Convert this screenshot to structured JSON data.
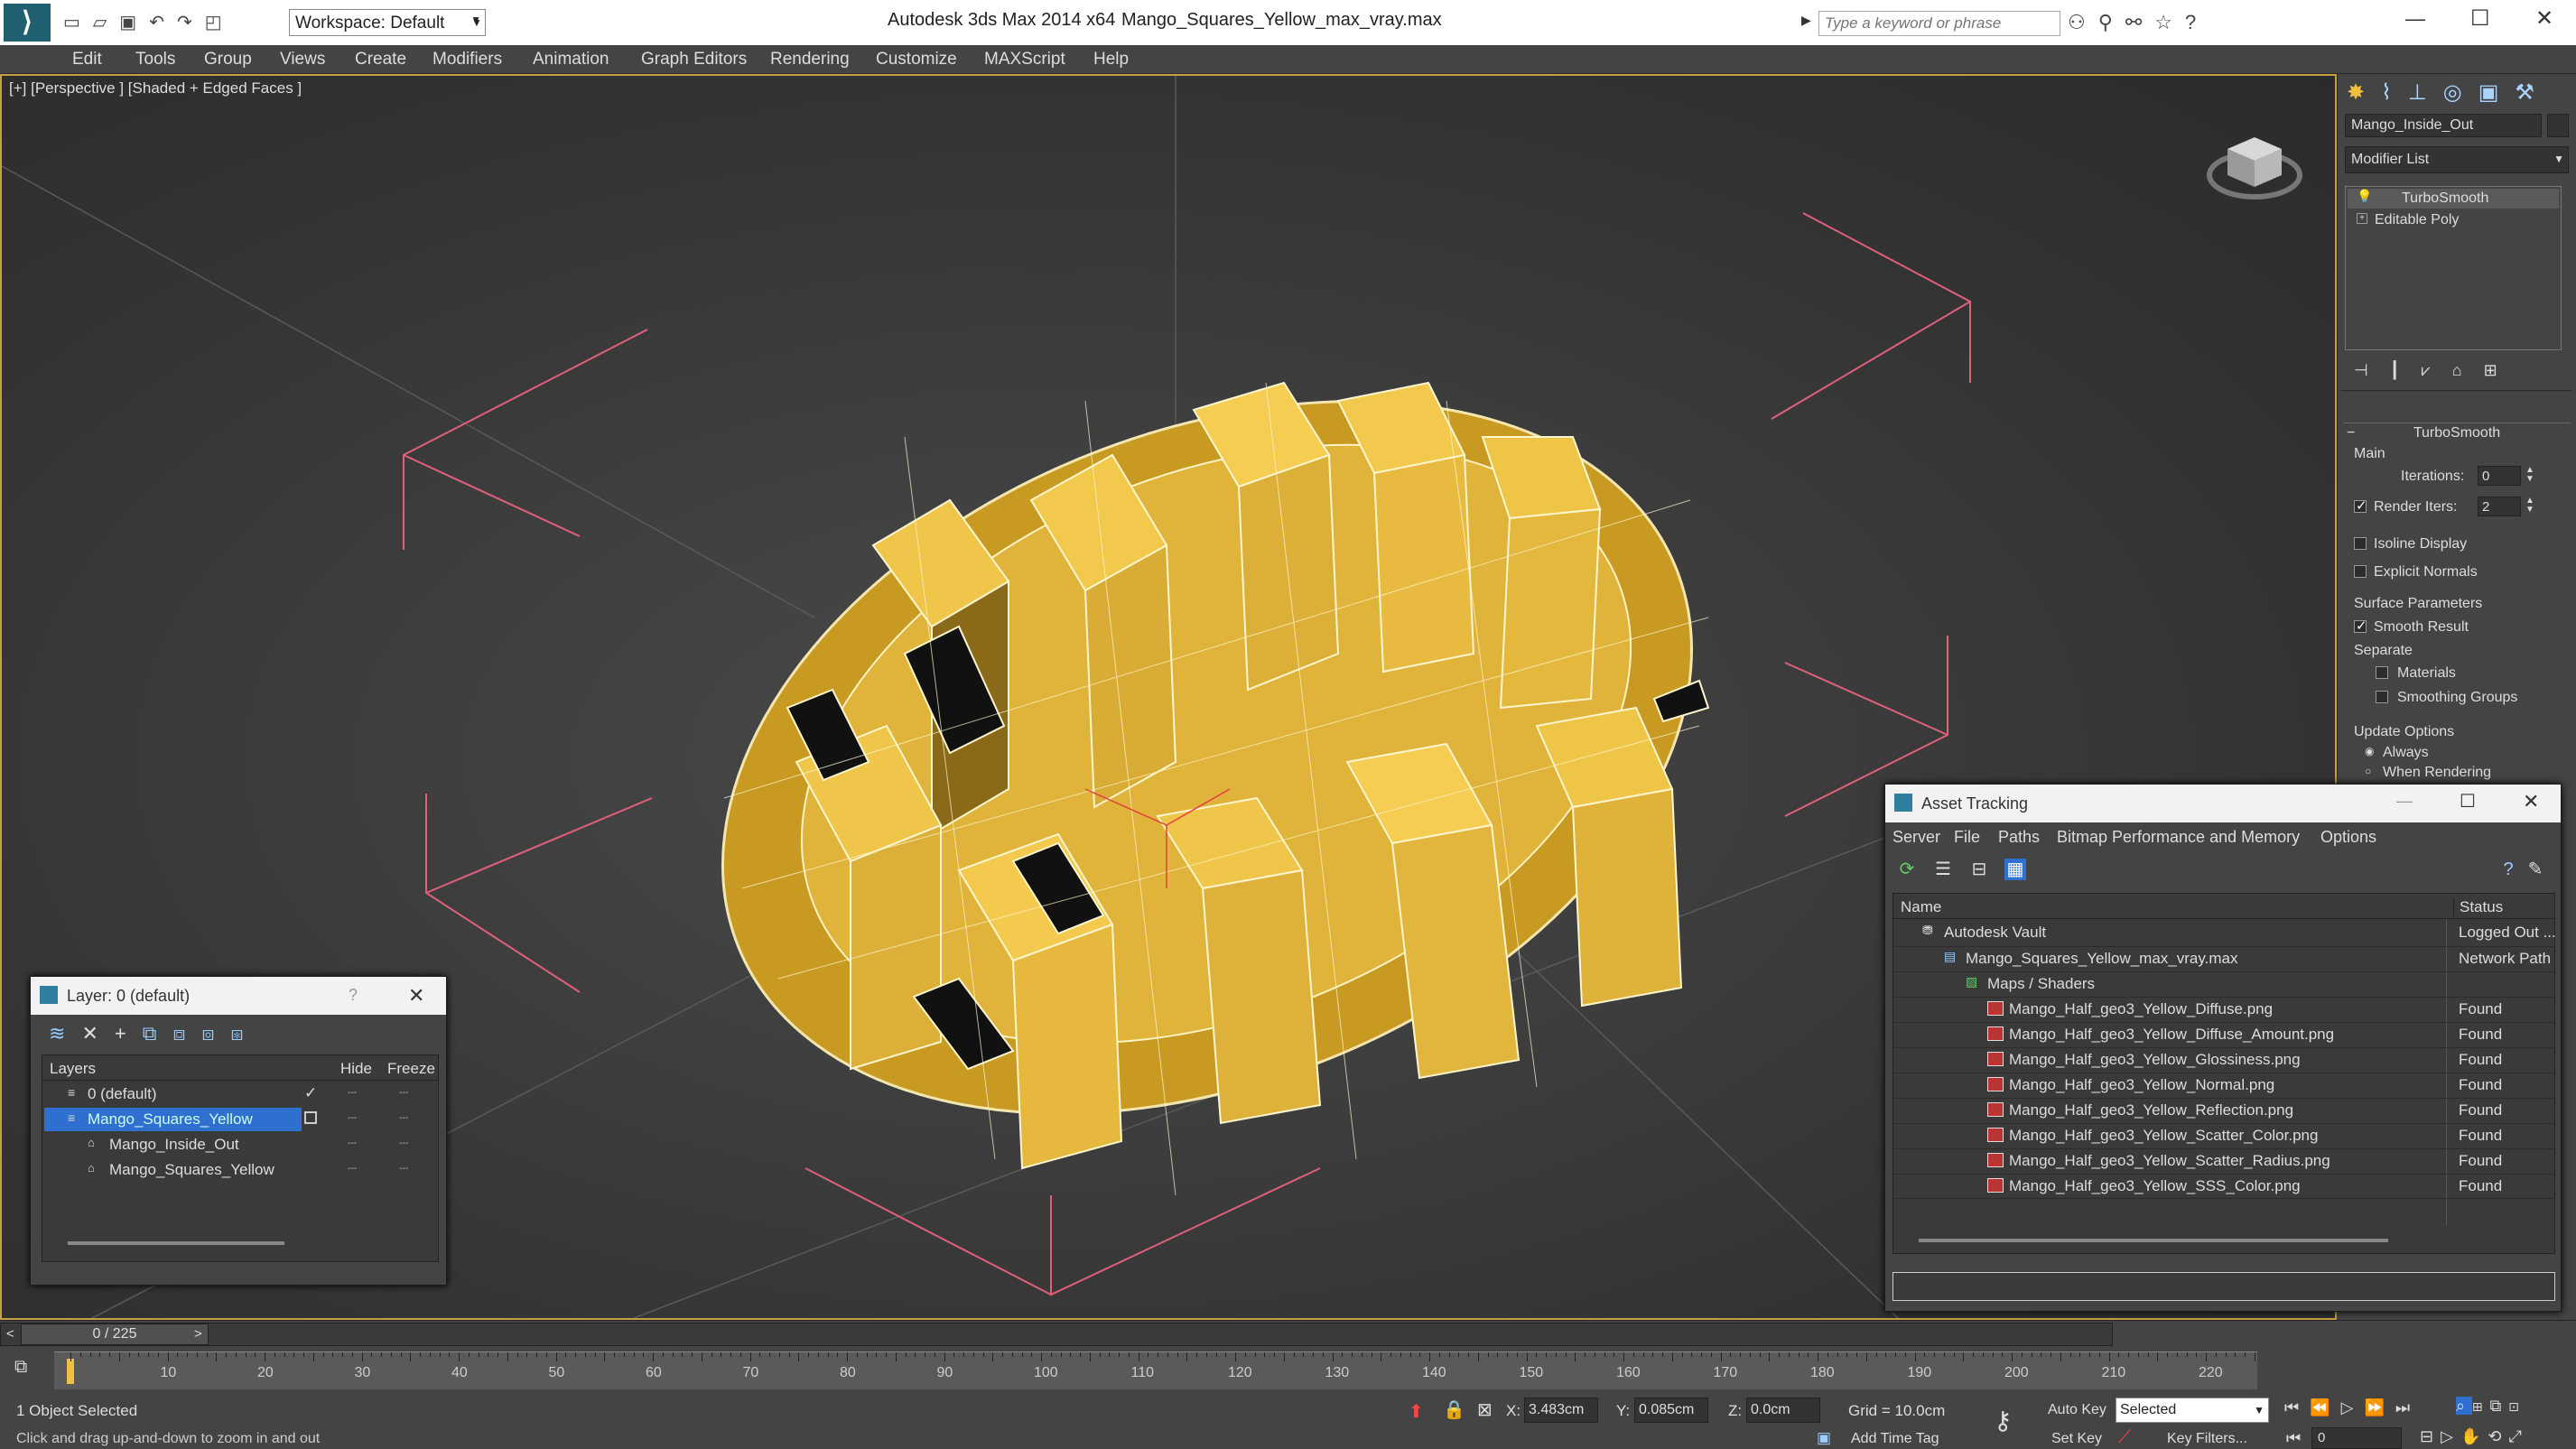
{
  "titlebar": {
    "workspace": "Workspace: Default",
    "app": "Autodesk 3ds Max  2014 x64",
    "file": "Mango_Squares_Yellow_max_vray.max",
    "search_placeholder": "Type a keyword or phrase"
  },
  "menu": [
    "Edit",
    "Tools",
    "Group",
    "Views",
    "Create",
    "Modifiers",
    "Animation",
    "Graph Editors",
    "Rendering",
    "Customize",
    "MAXScript",
    "Help"
  ],
  "viewport": {
    "label": "[+] [Perspective ] [Shaded + Edged Faces ]"
  },
  "command_panel": {
    "object_name": "Mango_Inside_Out",
    "modifier_list": "Modifier List",
    "stack": [
      "TurboSmooth",
      "Editable Poly"
    ],
    "rollout_title": "TurboSmooth",
    "main_label": "Main",
    "iterations_label": "Iterations:",
    "iterations_value": "0",
    "render_iters_label": "Render Iters:",
    "render_iters_value": "2",
    "isoline": "Isoline Display",
    "explicit_normals": "Explicit Normals",
    "surface_params": "Surface Parameters",
    "smooth_result": "Smooth Result",
    "separate": "Separate",
    "materials": "Materials",
    "smoothing_groups": "Smoothing Groups",
    "update_options": "Update Options",
    "always": "Always",
    "when_rendering": "When Rendering"
  },
  "layer_window": {
    "title": "Layer: 0 (default)",
    "col_layers": "Layers",
    "col_hide": "Hide",
    "col_freeze": "Freeze",
    "rows": [
      {
        "name": "0 (default)"
      },
      {
        "name": "Mango_Squares_Yellow"
      },
      {
        "name": "Mango_Inside_Out"
      },
      {
        "name": "Mango_Squares_Yellow"
      }
    ]
  },
  "asset_window": {
    "title": "Asset Tracking",
    "menu": [
      "Server",
      "File",
      "Paths",
      "Bitmap Performance and Memory",
      "Options"
    ],
    "col_name": "Name",
    "col_status": "Status",
    "rows": [
      {
        "name": "Autodesk Vault",
        "status": "Logged Out ..."
      },
      {
        "name": "Mango_Squares_Yellow_max_vray.max",
        "status": "Network Path"
      },
      {
        "name": "Maps / Shaders",
        "status": ""
      },
      {
        "name": "Mango_Half_geo3_Yellow_Diffuse.png",
        "status": "Found"
      },
      {
        "name": "Mango_Half_geo3_Yellow_Diffuse_Amount.png",
        "status": "Found"
      },
      {
        "name": "Mango_Half_geo3_Yellow_Glossiness.png",
        "status": "Found"
      },
      {
        "name": "Mango_Half_geo3_Yellow_Normal.png",
        "status": "Found"
      },
      {
        "name": "Mango_Half_geo3_Yellow_Reflection.png",
        "status": "Found"
      },
      {
        "name": "Mango_Half_geo3_Yellow_Scatter_Color.png",
        "status": "Found"
      },
      {
        "name": "Mango_Half_geo3_Yellow_Scatter_Radius.png",
        "status": "Found"
      },
      {
        "name": "Mango_Half_geo3_Yellow_SSS_Color.png",
        "status": "Found"
      }
    ]
  },
  "timeline": {
    "frame": "0 / 225",
    "ticks": [
      "10",
      "20",
      "30",
      "40",
      "50",
      "60",
      "70",
      "80",
      "90",
      "100",
      "110",
      "120",
      "130",
      "140",
      "150",
      "160",
      "170",
      "180",
      "190",
      "200",
      "210",
      "220"
    ]
  },
  "status": {
    "selected": "1 Object Selected",
    "prompt": "Click and drag up-and-down to zoom in and out",
    "x_label": "X:",
    "x_value": "3.483cm",
    "y_label": "Y:",
    "y_value": "0.085cm",
    "z_label": "Z:",
    "z_value": "0.0cm",
    "grid": "Grid = 10.0cm",
    "add_time_tag": "Add Time Tag",
    "auto_key": "Auto Key",
    "set_key": "Set Key",
    "selected_dropdown": "Selected",
    "key_filters": "Key Filters...",
    "frame_field": "0"
  }
}
